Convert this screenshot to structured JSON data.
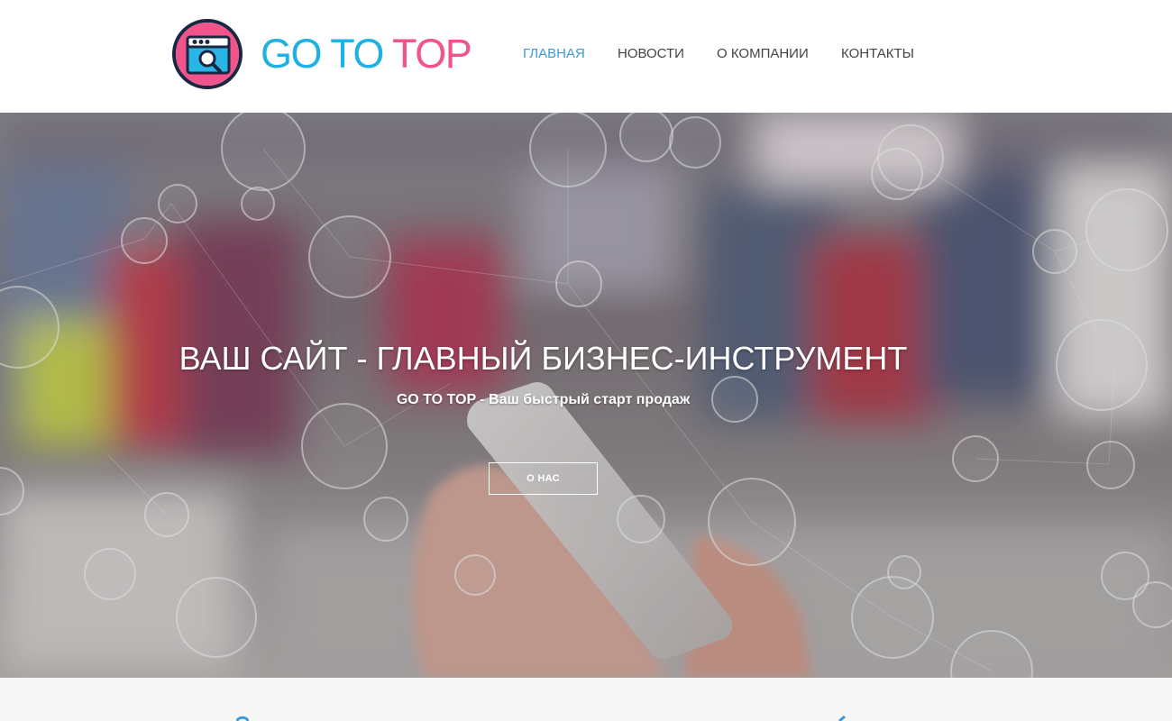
{
  "header": {
    "logo": {
      "icon": "browser-search-icon",
      "text_part_a": "GO TO ",
      "text_part_b": "TOP",
      "colors": {
        "blue": "#1fb1e3",
        "pink": "#f1538b",
        "navy": "#1b2740"
      }
    },
    "nav": [
      {
        "label": "ГЛАВНАЯ",
        "active": true
      },
      {
        "label": "НОВОСТИ",
        "active": false
      },
      {
        "label": "О КОМПАНИИ",
        "active": false
      },
      {
        "label": "КОНТАКТЫ",
        "active": false
      }
    ],
    "nav_active_color": "#3e9ad6"
  },
  "hero": {
    "title": "ВАШ САЙТ - ГЛАВНЫЙ БИЗНЕС-ИНСТРУМЕНТ",
    "subtitle": "GO TO TOP - Ваш быстрый старт продаж",
    "button_label": "О НАС",
    "background": "blurred-city-hand-holding-smartphone-network-icons"
  },
  "lower": {
    "icons": [
      "feature-icon-left",
      "feature-icon-right"
    ],
    "accent": "#3e9ad6"
  }
}
